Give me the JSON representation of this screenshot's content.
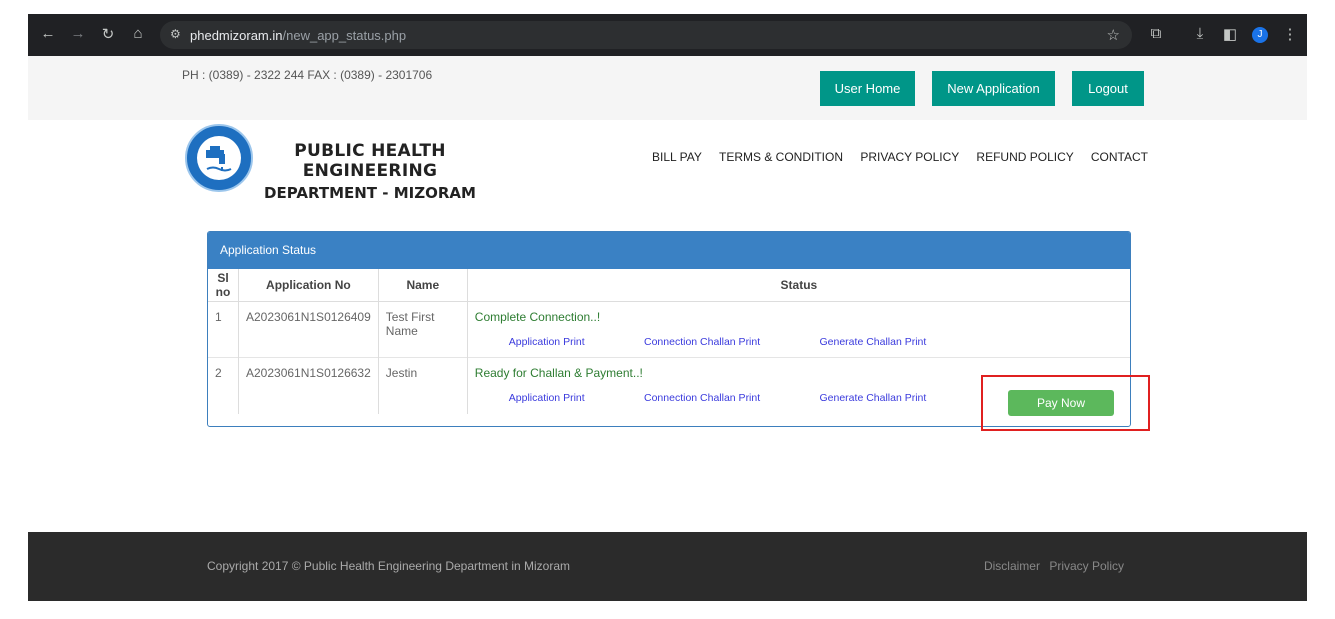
{
  "browser": {
    "url_host": "phedmizoram.in",
    "url_path": "/new_app_status.php",
    "profile_initial": "J"
  },
  "topbar": {
    "contact": "PH : (0389) - 2322 244   FAX : (0389) - 2301706",
    "buttons": {
      "user_home": "User Home",
      "new_application": "New Application",
      "logout": "Logout"
    }
  },
  "header": {
    "brand_line1": "PUBLIC HEALTH ENGINEERING",
    "brand_line2": "DEPARTMENT  - MIZORAM",
    "nav": [
      "BILL PAY",
      "TERMS & CONDITION",
      "PRIVACY POLICY",
      "REFUND POLICY",
      "CONTACT"
    ]
  },
  "panel": {
    "title": "Application Status",
    "columns": [
      "Sl no",
      "Application No",
      "Name",
      "Status"
    ],
    "rows": [
      {
        "sl": "1",
        "app_no": "A2023061N1S0126409",
        "name": "Test First Name",
        "status": "Complete Connection..!",
        "links": [
          "Application Print",
          "Connection Challan Print",
          "Generate Challan Print"
        ]
      },
      {
        "sl": "2",
        "app_no": "A2023061N1S0126632",
        "name": "Jestin",
        "status": "Ready for Challan & Payment..!",
        "links": [
          "Application Print",
          "Connection Challan Print",
          "Generate Challan Print"
        ]
      }
    ],
    "pay_now": "Pay Now"
  },
  "footer": {
    "copyright": "Copyright 2017 © Public Health Engineering Department in Mizoram",
    "links": [
      "Disclaimer",
      "Privacy Policy"
    ]
  },
  "colors": {
    "primary_button": "#009688",
    "panel_header": "#3a81c4",
    "success_button": "#5cb85c",
    "status_text": "#2e7d32",
    "highlight": "#e02020"
  }
}
